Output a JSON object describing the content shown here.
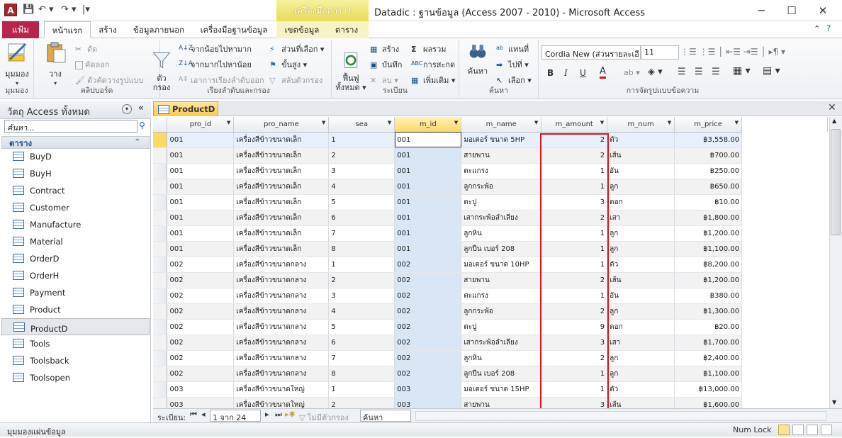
{
  "window": {
    "app_icon_letter": "A",
    "title": "Datadic : ฐานข้อมูล (Access 2007 - 2010) - Microsoft Access",
    "context_title": "เครื่องมือตาราง",
    "min": "─",
    "max": "☐",
    "close": "✕"
  },
  "qat": {
    "save": "💾",
    "undo": "↶ ▾",
    "redo": "↷ ▾",
    "more": "|▾"
  },
  "tabs": {
    "file": "แฟ้ม",
    "home": "หน้าแรก",
    "create": "สร้าง",
    "external": "ข้อมูลภายนอก",
    "dbtools": "เครื่องมือฐานข้อมูล",
    "fields": "เขตข้อมูล",
    "table": "ตาราง"
  },
  "ribbon": {
    "views": {
      "view": "มุมมอง",
      "group": "มุมมอง"
    },
    "clipboard": {
      "paste": "วาง",
      "cut": "ตัด",
      "copy": "คัดลอก",
      "format_painter": "ตัวคัดวางรูปแบบ",
      "group": "คลิปบอร์ด"
    },
    "sort": {
      "filter": "ตัว\nกรอง",
      "asc": "จากน้อยไปหามาก",
      "desc": "จากมากไปหาน้อย",
      "remove_sort": "เอาการเรียงลำดับออก",
      "selection": "ส่วนที่เลือก ▾",
      "advanced": "ขั้นสูง ▾",
      "toggle": "สลับตัวกรอง",
      "group": "เรียงลำดับและกรอง"
    },
    "records": {
      "refresh": "ฟื้นฟู\nทั้งหมด ▾",
      "new": "สร้าง",
      "save": "บันทึก",
      "delete": "ลบ ▾",
      "totals": "ผลรวม",
      "spelling": "การสะกด",
      "more": "เพิ่มเติม ▾",
      "group": "ระเบียน"
    },
    "find": {
      "find": "ค้นหา",
      "replace": "แทนที่",
      "goto": "ไปที่ ▾",
      "select": "เลือก ▾",
      "group": "ค้นหา"
    },
    "text": {
      "font": "Cordia New (ส่วนรายละเอี",
      "size": "11",
      "group": "การจัดรูปแบบข้อความ",
      "bold": "B",
      "italic": "I",
      "underline": "U"
    }
  },
  "nav": {
    "title": "วัตถุ Access ทั้งหมด",
    "search_placeholder": "ค้นหา...",
    "section": "ตาราง",
    "items": [
      "BuyD",
      "BuyH",
      "Contract",
      "Customer",
      "Manufacture",
      "Material",
      "OrderD",
      "OrderH",
      "Payment",
      "Product",
      "ProductD",
      "Tools",
      "Toolsback",
      "Toolsopen"
    ]
  },
  "document": {
    "tab": "ProductD"
  },
  "grid": {
    "columns": [
      "pro_id",
      "pro_name",
      "sea",
      "m_id",
      "m_name",
      "m_amount",
      "m_num",
      "m_price"
    ],
    "rows": [
      [
        "001",
        "เครื่องสีข้าวขนาดเล็ก",
        "1",
        "001",
        "มอเตอร์ ขนาด 5HP",
        "2",
        "ตัว",
        "฿3,558.00"
      ],
      [
        "001",
        "เครื่องสีข้าวขนาดเล็ก",
        "2",
        "001",
        "สายพาน",
        "2",
        "เส้น",
        "฿700.00"
      ],
      [
        "001",
        "เครื่องสีข้าวขนาดเล็ก",
        "3",
        "001",
        "ตะแกรง",
        "1",
        "อัน",
        "฿250.00"
      ],
      [
        "001",
        "เครื่องสีข้าวขนาดเล็ก",
        "4",
        "001",
        "ลูกกระพ้อ",
        "1",
        "ลูก",
        "฿650.00"
      ],
      [
        "001",
        "เครื่องสีข้าวขนาดเล็ก",
        "5",
        "001",
        "ตะปู",
        "3",
        "ดอก",
        "฿10.00"
      ],
      [
        "001",
        "เครื่องสีข้าวขนาดเล็ก",
        "6",
        "001",
        "เสากระพ้อลำเลียง",
        "2",
        "เสา",
        "฿1,800.00"
      ],
      [
        "001",
        "เครื่องสีข้าวขนาดเล็ก",
        "7",
        "001",
        "ลูกหิน",
        "1",
        "ลูก",
        "฿1,200.00"
      ],
      [
        "001",
        "เครื่องสีข้าวขนาดเล็ก",
        "8",
        "001",
        "ลูกปืน เบอร์ 208",
        "1",
        "ลูก",
        "฿1,100.00"
      ],
      [
        "002",
        "เครื่องสีข้าวขนาดกลาง",
        "1",
        "002",
        "มอเตอร์ ขนาด 10HP",
        "1",
        "ตัว",
        "฿8,200.00"
      ],
      [
        "002",
        "เครื่องสีข้าวขนาดกลาง",
        "2",
        "002",
        "สายพาน",
        "2",
        "เส้น",
        "฿1,200.00"
      ],
      [
        "002",
        "เครื่องสีข้าวขนาดกลาง",
        "3",
        "002",
        "ตะแกรง",
        "1",
        "อัน",
        "฿380.00"
      ],
      [
        "002",
        "เครื่องสีข้าวขนาดกลาง",
        "4",
        "002",
        "ลูกกระพ้อ",
        "2",
        "ลูก",
        "฿1,300.00"
      ],
      [
        "002",
        "เครื่องสีข้าวขนาดกลาง",
        "5",
        "002",
        "ตะปู",
        "9",
        "ดอก",
        "฿20.00"
      ],
      [
        "002",
        "เครื่องสีข้าวขนาดกลาง",
        "6",
        "002",
        "เสากระพ้อลำเลียง",
        "3",
        "เสา",
        "฿1,700.00"
      ],
      [
        "002",
        "เครื่องสีข้าวขนาดกลาง",
        "7",
        "002",
        "ลูกหิน",
        "2",
        "ลูก",
        "฿2,400.00"
      ],
      [
        "002",
        "เครื่องสีข้าวขนาดกลาง",
        "8",
        "002",
        "ลูกปืน เบอร์ 208",
        "1",
        "ลูก",
        "฿1,100.00"
      ],
      [
        "003",
        "เครื่องสีข้าวขนาดใหญ่",
        "1",
        "003",
        "มอเตอร์ ขนาด 15HP",
        "1",
        "ตัว",
        "฿13,000.00"
      ],
      [
        "003",
        "เครื่องสีข้าวขนาดใหญ่",
        "2",
        "003",
        "สายพาน",
        "3",
        "เส้น",
        "฿1,600.00"
      ]
    ],
    "selected_column": "m_id"
  },
  "record_nav": {
    "label": "ระเบียน:",
    "position": "1 จาก 24",
    "filter": "ไม่มีตัวกรอง",
    "search": "ค้นหา"
  },
  "status": {
    "left": "มุมมองแผ่นข้อมูล",
    "numlock": "Num Lock"
  },
  "colors": {
    "file_tab": "#b6254c",
    "context": "#eadb58",
    "highlight": "#e0141e"
  }
}
